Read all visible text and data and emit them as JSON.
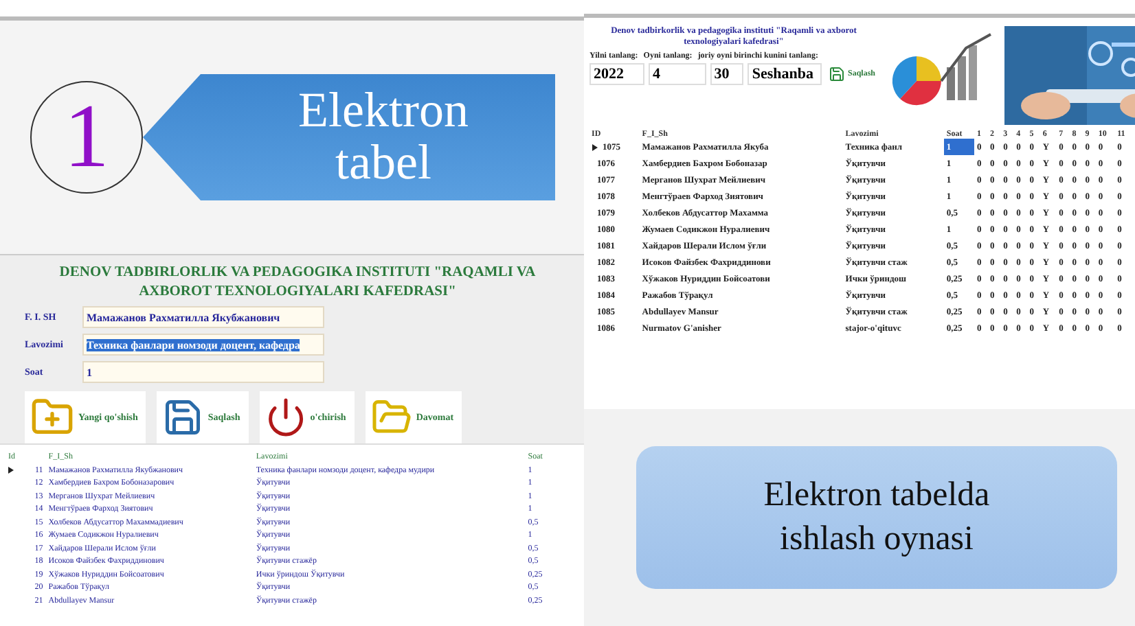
{
  "callout": {
    "number": "1",
    "label": "Elektron tabel"
  },
  "employee_form": {
    "heading": "DENOV TADBIRLORLIK VA PEDAGOGIKA INSTITUTI \"RAQAMLI VA AXBOROT TEXNOLOGIYALARI KAFEDRASI\"",
    "fields": [
      {
        "label": "F. I. SH",
        "value": "Мамажанов Рахматилла Якубжанович",
        "selected": false
      },
      {
        "label": "Lavozimi",
        "value": "Техника фанлари номзоди доцент, кафедра",
        "selected": true
      },
      {
        "label": "Soat",
        "value": "1",
        "selected": false
      }
    ],
    "buttons": [
      {
        "kind": "new",
        "label": "Yangi qo'shish"
      },
      {
        "kind": "save",
        "label": "Saqlash"
      },
      {
        "kind": "delete",
        "label": "o'chirish"
      },
      {
        "kind": "attendance",
        "label": "Davomat"
      }
    ]
  },
  "employee_grid": {
    "columns": [
      "Id",
      "F_I_Sh",
      "Lavozimi",
      "Soat"
    ],
    "rows": [
      {
        "selected": true,
        "cells": [
          "11",
          "Мамажанов Рахматилла Якубжанович",
          "Техника фанлари номзоди доцент, кафедра мудири",
          "1"
        ]
      },
      {
        "selected": false,
        "cells": [
          "12",
          "Хамбердиев Бахром Бобоназарович",
          "Ўқитувчи",
          "1"
        ]
      },
      {
        "selected": false,
        "cells": [
          "13",
          "Мерганов Шухрат Мейлиевич",
          "Ўқитувчи",
          "1"
        ]
      },
      {
        "selected": false,
        "cells": [
          "14",
          "Менгтўраев Фарход Зиятович",
          "Ўқитувчи",
          "1"
        ]
      },
      {
        "selected": false,
        "cells": [
          "15",
          "Холбеков Абдусаттор Махаммадиевич",
          "Ўқитувчи",
          "0,5"
        ]
      },
      {
        "selected": false,
        "cells": [
          "16",
          "Жумаев Содикжон Нуралиевич",
          "Ўқитувчи",
          "1"
        ]
      },
      {
        "selected": false,
        "cells": [
          "17",
          "Хайдаров Шерали Ислом ўғли",
          "Ўқитувчи",
          "0,5"
        ]
      },
      {
        "selected": false,
        "cells": [
          "18",
          "Исоков Файзбек Фахриддинович",
          "Ўқитувчи стажёр",
          "0,5"
        ]
      },
      {
        "selected": false,
        "cells": [
          "19",
          "Хўжаков Нуриддин Бойсоатович",
          "Ички ўриндош Ўқитувчи",
          "0,25"
        ]
      },
      {
        "selected": false,
        "cells": [
          "20",
          "Ражабов Тўрақул",
          "Ўқитувчи",
          "0,5"
        ]
      },
      {
        "selected": false,
        "cells": [
          "21",
          "Abdullayev Mansur",
          "Ўқитувчи стажёр",
          "0,25"
        ]
      }
    ]
  },
  "timesheet": {
    "heading": "Denov tadbirkorlik va pedagogika instituti \"Raqamli va axborot texnologiyalari kafedrasi\"",
    "labels": [
      "Yilni tanlang:",
      "Oyni tanlang:",
      "joriy oyni birinchi kunini tanlang:"
    ],
    "year": "2022",
    "month": "4",
    "day": "30",
    "weekday": "Seshanba",
    "save_button": "Saqlash",
    "columns": [
      "ID",
      "F_I_Sh",
      "Lavozimi",
      "Soat",
      "1",
      "2",
      "3",
      "4",
      "5",
      "6",
      "7",
      "8",
      "9",
      "10",
      "11"
    ],
    "rows": [
      {
        "selected": true,
        "cells": [
          "1075",
          "Мамажанов Рахматилла Якуба",
          "Техника фанл",
          "1",
          "0",
          "0",
          "0",
          "0",
          "0",
          "Y",
          "0",
          "0",
          "0",
          "0",
          "0"
        ]
      },
      {
        "selected": false,
        "cells": [
          "1076",
          "Хамбердиев Бахром Бобоназар",
          "Ўқитувчи",
          "1",
          "0",
          "0",
          "0",
          "0",
          "0",
          "Y",
          "0",
          "0",
          "0",
          "0",
          "0"
        ]
      },
      {
        "selected": false,
        "cells": [
          "1077",
          "Мерганов Шухрат Мейлиевич",
          "Ўқитувчи",
          "1",
          "0",
          "0",
          "0",
          "0",
          "0",
          "Y",
          "0",
          "0",
          "0",
          "0",
          "0"
        ]
      },
      {
        "selected": false,
        "cells": [
          "1078",
          "Менгтўраев Фарход Зиятович",
          "Ўқитувчи",
          "1",
          "0",
          "0",
          "0",
          "0",
          "0",
          "Y",
          "0",
          "0",
          "0",
          "0",
          "0"
        ]
      },
      {
        "selected": false,
        "cells": [
          "1079",
          "Холбеков Абдусаттор Махамма",
          "Ўқитувчи",
          "0,5",
          "0",
          "0",
          "0",
          "0",
          "0",
          "Y",
          "0",
          "0",
          "0",
          "0",
          "0"
        ]
      },
      {
        "selected": false,
        "cells": [
          "1080",
          "Жумаев Содикжон Нуралиевич",
          "Ўқитувчи",
          "1",
          "0",
          "0",
          "0",
          "0",
          "0",
          "Y",
          "0",
          "0",
          "0",
          "0",
          "0"
        ]
      },
      {
        "selected": false,
        "cells": [
          "1081",
          "Хайдаров Шерали Ислом ўғли",
          "Ўқитувчи",
          "0,5",
          "0",
          "0",
          "0",
          "0",
          "0",
          "Y",
          "0",
          "0",
          "0",
          "0",
          "0"
        ]
      },
      {
        "selected": false,
        "cells": [
          "1082",
          "Исоков Файзбек Фахриддинови",
          "Ўқитувчи стаж",
          "0,5",
          "0",
          "0",
          "0",
          "0",
          "0",
          "Y",
          "0",
          "0",
          "0",
          "0",
          "0"
        ]
      },
      {
        "selected": false,
        "cells": [
          "1083",
          "Хўжаков Нуриддин Бойсоатови",
          "Ички ўриндош",
          "0,25",
          "0",
          "0",
          "0",
          "0",
          "0",
          "Y",
          "0",
          "0",
          "0",
          "0",
          "0"
        ]
      },
      {
        "selected": false,
        "cells": [
          "1084",
          "Ражабов Тўрақул",
          "Ўқитувчи",
          "0,5",
          "0",
          "0",
          "0",
          "0",
          "0",
          "Y",
          "0",
          "0",
          "0",
          "0",
          "0"
        ]
      },
      {
        "selected": false,
        "cells": [
          "1085",
          "Abdullayev Mansur",
          "Ўқитувчи стаж",
          "0,25",
          "0",
          "0",
          "0",
          "0",
          "0",
          "Y",
          "0",
          "0",
          "0",
          "0",
          "0"
        ]
      },
      {
        "selected": false,
        "cells": [
          "1086",
          "Nurmatov G'anisher",
          "stajor-o'qituvc",
          "0,25",
          "0",
          "0",
          "0",
          "0",
          "0",
          "Y",
          "0",
          "0",
          "0",
          "0",
          "0"
        ]
      }
    ]
  },
  "caption": {
    "text": "Elektron tabelda ishlash oynasi"
  }
}
